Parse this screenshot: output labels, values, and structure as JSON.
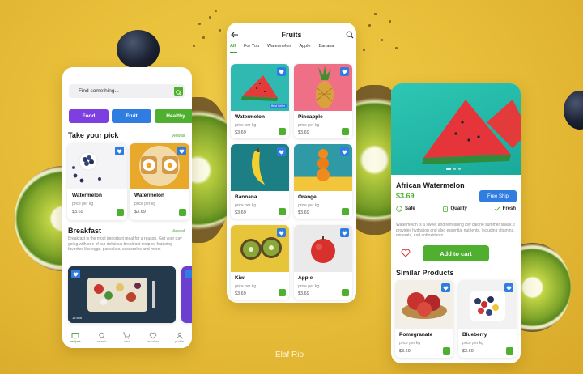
{
  "author": "Elaf Rio",
  "home": {
    "search": {
      "placeholder": "Find something..."
    },
    "chips": [
      {
        "label": "Food",
        "color": "#7d3fdf"
      },
      {
        "label": "Fruit",
        "color": "#2f7de1"
      },
      {
        "label": "Healthy",
        "color": "#4faf2f"
      }
    ],
    "take_your_pick": {
      "title": "Take your pick",
      "view_all": "View all",
      "cards": [
        {
          "name": "Watermelon",
          "unit": "price per kg",
          "price": "$3.69"
        },
        {
          "name": "Watermelon",
          "unit": "price per kg",
          "price": "$3.69"
        }
      ]
    },
    "breakfast": {
      "title": "Breakfast",
      "view_all": "View all",
      "description": "Breakfast is the most important meal for a reason. Get your day going with one of our delicious breakfast recipes, featuring favorites like eggs, pancakes, casseroles and more.",
      "image_tag": "15 Min"
    },
    "nav": [
      {
        "label": "recipes",
        "icon": "book-icon",
        "active": true
      },
      {
        "label": "search",
        "icon": "search-icon",
        "active": false
      },
      {
        "label": "cart",
        "icon": "cart-icon",
        "active": false
      },
      {
        "label": "favorites",
        "icon": "heart-icon",
        "active": false
      },
      {
        "label": "profile",
        "icon": "user-icon",
        "active": false
      }
    ]
  },
  "fruits": {
    "title": "Fruits",
    "tabs": [
      "All",
      "For You",
      "Watermelon",
      "Apple",
      "Banana"
    ],
    "active_tab": "All",
    "items": [
      {
        "name": "Watermelon",
        "unit": "price per kg",
        "price": "$3.69",
        "badge": "Best Seller"
      },
      {
        "name": "Pineapple",
        "unit": "price per kg",
        "price": "$3.69"
      },
      {
        "name": "Bannana",
        "unit": "price per kg",
        "price": "$3.69"
      },
      {
        "name": "Orange",
        "unit": "price per kg",
        "price": "$3.69"
      },
      {
        "name": "Kiwi",
        "unit": "price per kg",
        "price": "$3.69"
      },
      {
        "name": "Apple",
        "unit": "price per kg",
        "price": "$3.69"
      }
    ]
  },
  "detail": {
    "name": "African Watermelon",
    "price": "$3.69",
    "free_ship": "Free Ship",
    "features": [
      "Safe",
      "Quality",
      "Fresh"
    ],
    "description": "Watermelon is a sweet and refreshing low calorie summer snack.It provides hydration and also essential nutrients, including vitamins, minerals, and antioxidants.",
    "add_to_cart": "Add to cart",
    "similar_title": "Similar Products",
    "similar": [
      {
        "name": "Pomegranate",
        "unit": "price per kg",
        "price": "$3.69"
      },
      {
        "name": "Blueberry",
        "unit": "price per kg",
        "price": "$3.69"
      }
    ]
  },
  "colors": {
    "accent_green": "#4faf2f",
    "accent_blue": "#2f7de1",
    "accent_purple": "#7d3fdf",
    "background": "#ebc23c"
  }
}
